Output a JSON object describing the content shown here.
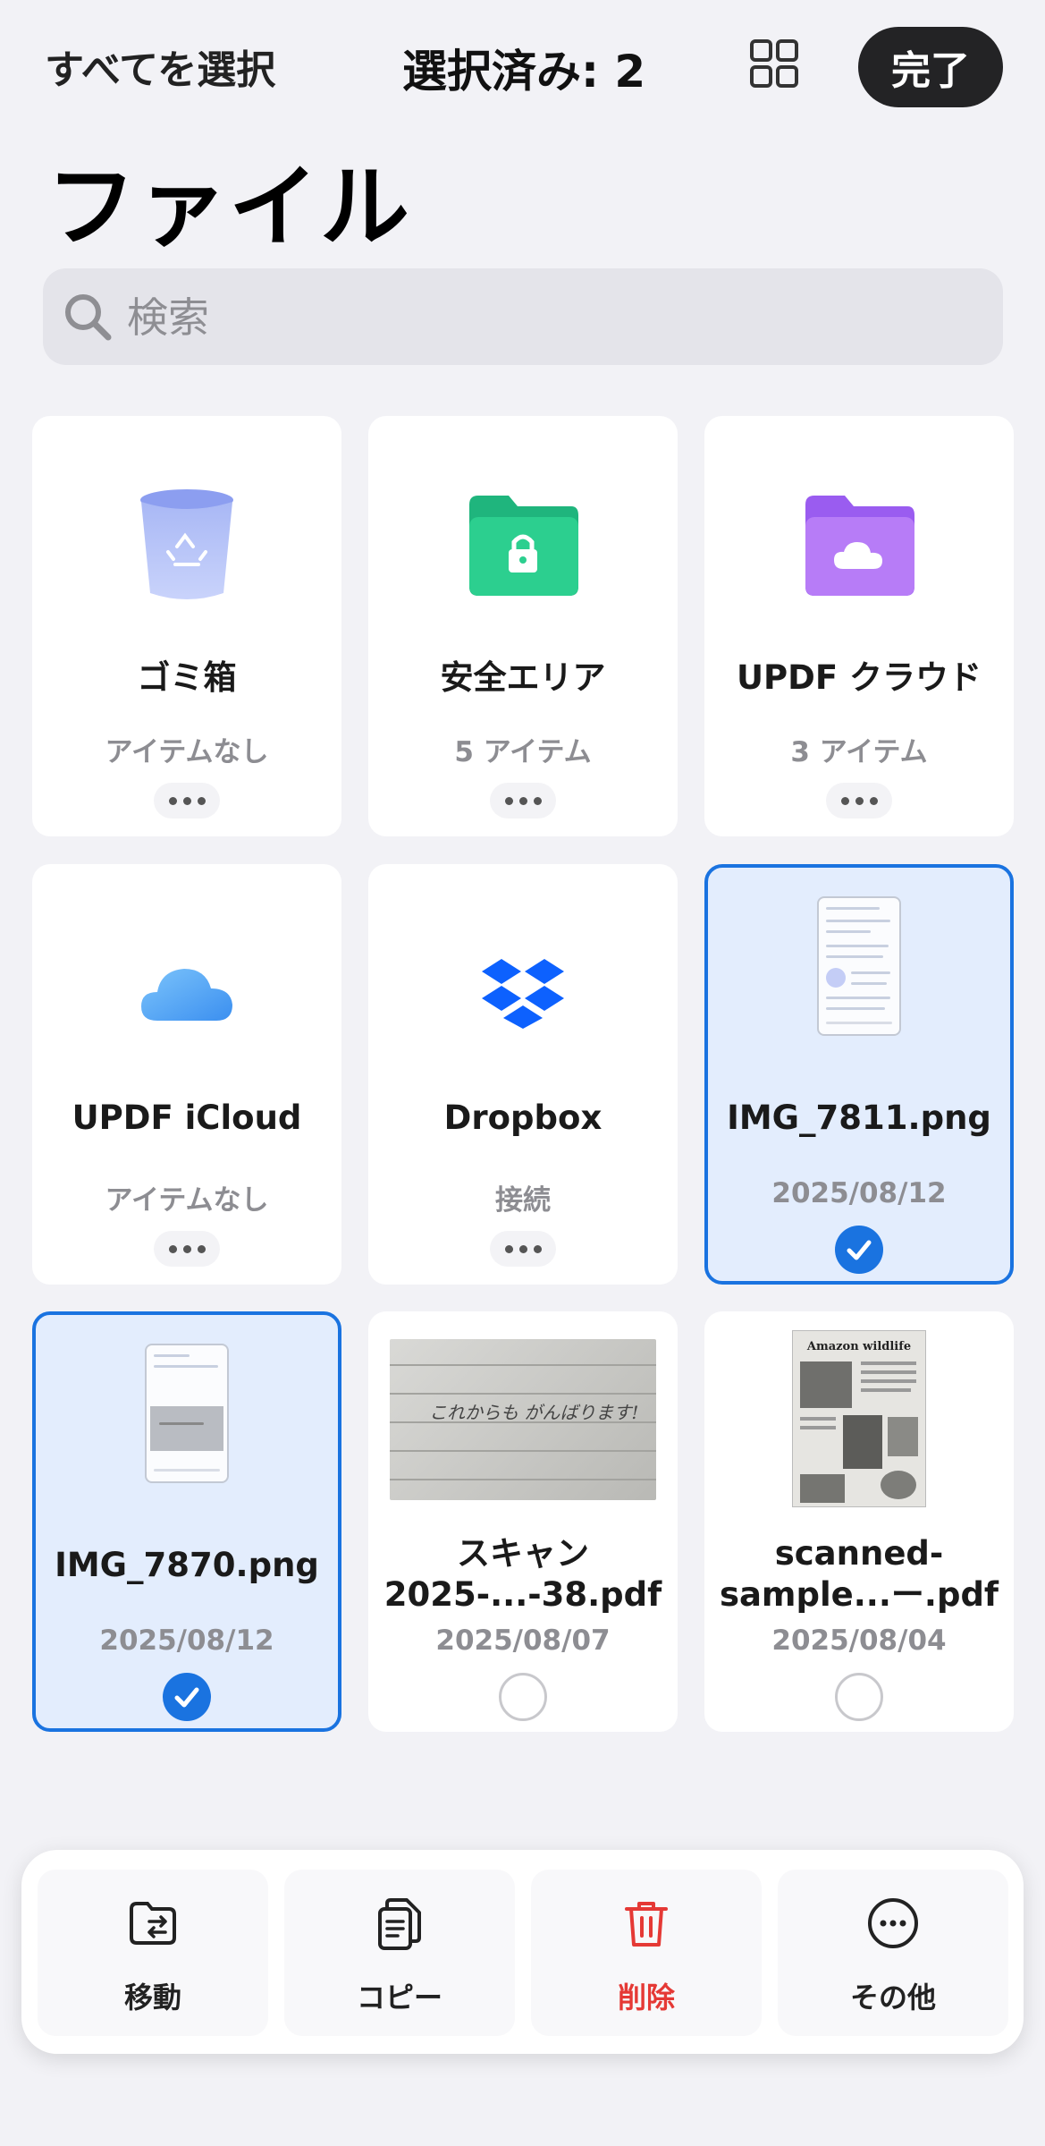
{
  "header": {
    "select_all": "すべてを選択",
    "selection_count": "選択済み: 2",
    "done": "完了"
  },
  "title": "ファイル",
  "search": {
    "placeholder": "検索",
    "value": ""
  },
  "items": [
    {
      "name": "ゴミ箱",
      "sub": "アイテムなし",
      "icon": "trash-icon"
    },
    {
      "name": "安全エリア",
      "sub": "5 アイテム",
      "icon": "lock-folder-icon"
    },
    {
      "name": "UPDF クラウド",
      "sub": "3 アイテム",
      "icon": "cloud-folder-icon"
    },
    {
      "name": "UPDF iCloud",
      "sub": "アイテムなし",
      "icon": "icloud-icon"
    },
    {
      "name": "Dropbox",
      "sub": "接続",
      "icon": "dropbox-icon"
    },
    {
      "name": "IMG_7811.png",
      "sub": "2025/08/12",
      "selected": true
    },
    {
      "name": "IMG_7870.png",
      "sub": "2025/08/12",
      "selected": true
    },
    {
      "name": "スキャン",
      "name2": "2025-...-38.pdf",
      "sub": "2025/08/07",
      "selected": false
    },
    {
      "name": "scanned-",
      "name2": "sample...ー.pdf",
      "sub": "2025/08/04",
      "selected": false
    }
  ],
  "thumb_text": {
    "amazon": "Amazon wildlife",
    "handwriting": "これからも がんばります!"
  },
  "toolbar": {
    "move": "移動",
    "copy": "コピー",
    "delete": "削除",
    "more": "その他"
  },
  "colors": {
    "accent": "#1a73e0",
    "danger": "#e53935",
    "selected_bg": "#e3edfd"
  }
}
